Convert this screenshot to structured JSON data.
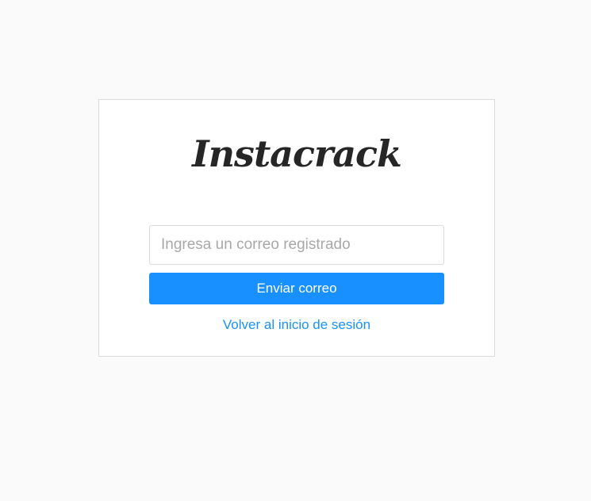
{
  "brand": {
    "logo_text": "Instacrack"
  },
  "form": {
    "email_placeholder": "Ingresa un correo registrado",
    "email_value": "",
    "submit_label": "Enviar correo",
    "back_link_label": "Volver al inicio de sesión"
  },
  "colors": {
    "background": "#fafafa",
    "card": "#ffffff",
    "border": "#dbdbdb",
    "accent": "#1890ff",
    "logo": "#262626"
  }
}
